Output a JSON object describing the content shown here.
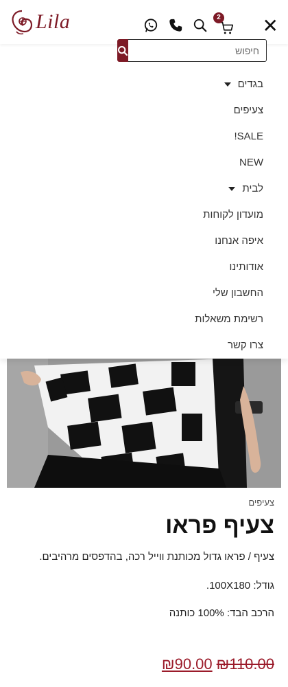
{
  "brand": {
    "name": "Lila",
    "accent": "#7d1a26"
  },
  "header": {
    "icons": [
      "whatsapp-icon",
      "phone-icon",
      "search-icon",
      "cart-icon",
      "close-icon"
    ],
    "cart_count": "2",
    "close_glyph": "✕"
  },
  "search": {
    "placeholder": "חיפוש",
    "value": ""
  },
  "menu": {
    "items": [
      {
        "label": "בגדים",
        "has_submenu": true
      },
      {
        "label": "צעיפים",
        "has_submenu": false
      },
      {
        "label": "SALE!",
        "has_submenu": false
      },
      {
        "label": "NEW",
        "has_submenu": false
      },
      {
        "label": "לבית",
        "has_submenu": true
      },
      {
        "label": "מועדון לקוחות",
        "has_submenu": false
      },
      {
        "label": "איפה אנחנו",
        "has_submenu": false
      },
      {
        "label": "אודותינו",
        "has_submenu": false
      },
      {
        "label": "החשבון שלי",
        "has_submenu": false
      },
      {
        "label": "רשימת משאלות",
        "has_submenu": false
      },
      {
        "label": "צרו קשר",
        "has_submenu": false
      }
    ]
  },
  "product": {
    "category": "צעיפים",
    "title": "צעיף פראו",
    "description": "צעיף / פראו גדול מכותנת ווייל רכה, בהדפסים מרהיבים.",
    "size": "גודל: 100X180.",
    "composition": "הרכב הבד: 100% כותנה",
    "price_old": "₪110.00",
    "price_new": "₪90.00"
  }
}
